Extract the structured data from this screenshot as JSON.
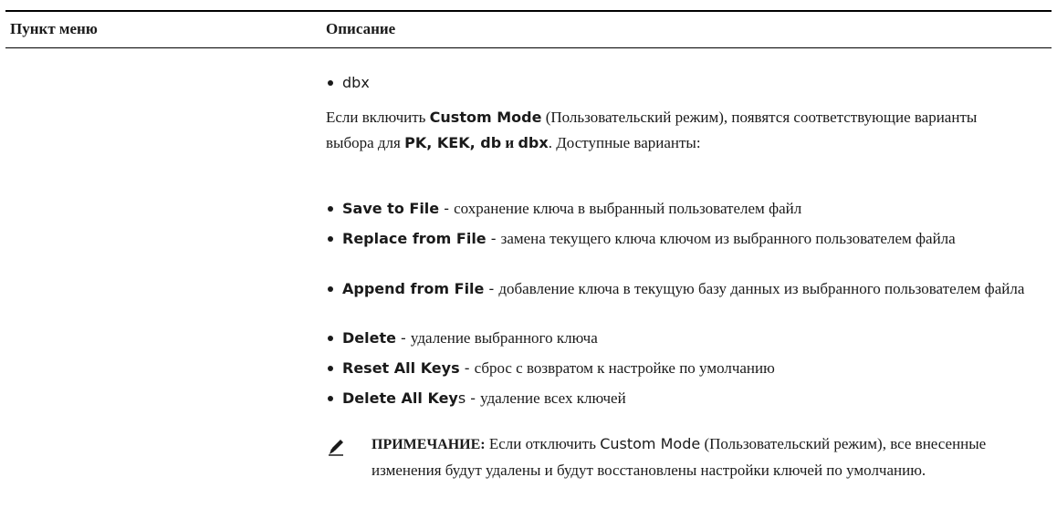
{
  "table": {
    "col1_header": "Пункт меню",
    "col2_header": "Описание"
  },
  "top_bullet": "dbx",
  "custom_mode_para": {
    "part1": "Если включить ",
    "custom_mode": "Custom Mode",
    "part2": " (Пользовательский режим), появятся соответствующие варианты выбора для ",
    "keys": "PK, KEK, db",
    "and": " и ",
    "dbx": "dbx",
    "part3": ". Доступные варианты:"
  },
  "options": [
    {
      "name": "Save to File",
      "sep": " - ",
      "desc": "сохранение ключа в выбранный пользователем файл"
    },
    {
      "name": "Replace from File",
      "sep": " - ",
      "desc": "замена текущего ключа ключом из выбранного пользователем файла"
    },
    {
      "name": "Append from File",
      "sep": " - ",
      "desc": "добавление ключа в текущую базу данных из выбранного пользователем файла"
    },
    {
      "name": "Delete",
      "sep": " - ",
      "desc": "удаление выбранного ключа"
    },
    {
      "name": "Reset All Keys",
      "sep": " - ",
      "desc": "сброс с возвратом к настройке по умолчанию"
    },
    {
      "name": "Delete All Key",
      "name_tail": "s",
      "sep": " - ",
      "desc": "удаление всех ключей"
    }
  ],
  "note": {
    "icon": "pencil-icon",
    "label": "ПРИМЕЧАНИЕ:",
    "text1": " Если отключить ",
    "custom_mode": "Custom Mode",
    "text2": " (Пользовательский режим), все внесенные изменения будут удалены и будут восстановлены настройки ключей по умолчанию."
  }
}
